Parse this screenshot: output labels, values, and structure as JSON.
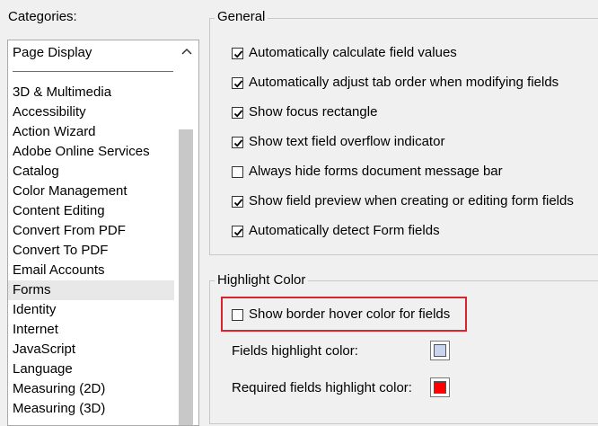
{
  "categories": {
    "label": "Categories:",
    "pinned": "Page Display",
    "items": [
      "3D & Multimedia",
      "Accessibility",
      "Action Wizard",
      "Adobe Online Services",
      "Catalog",
      "Color Management",
      "Content Editing",
      "Convert From PDF",
      "Convert To PDF",
      "Email Accounts",
      "Forms",
      "Identity",
      "Internet",
      "JavaScript",
      "Language",
      "Measuring (2D)",
      "Measuring (3D)"
    ],
    "selected": "Forms"
  },
  "general": {
    "title": "General",
    "options": [
      {
        "label": "Automatically calculate field values",
        "checked": true
      },
      {
        "label": "Automatically adjust tab order when modifying fields",
        "checked": true
      },
      {
        "label": "Show focus rectangle",
        "checked": true
      },
      {
        "label": "Show text field overflow indicator",
        "checked": true
      },
      {
        "label": "Always hide forms document message bar",
        "checked": false
      },
      {
        "label": "Show field preview when creating or editing form fields",
        "checked": true
      },
      {
        "label": "Automatically detect Form fields",
        "checked": true
      }
    ]
  },
  "highlight": {
    "title": "Highlight Color",
    "hover_option": {
      "label": "Show border hover color for fields",
      "checked": false
    },
    "fields_label": "Fields highlight color:",
    "fields_color": "#c8d4f0",
    "required_label": "Required fields highlight color:",
    "required_color": "#ff0000",
    "emphasis_color": "#d9232e"
  }
}
